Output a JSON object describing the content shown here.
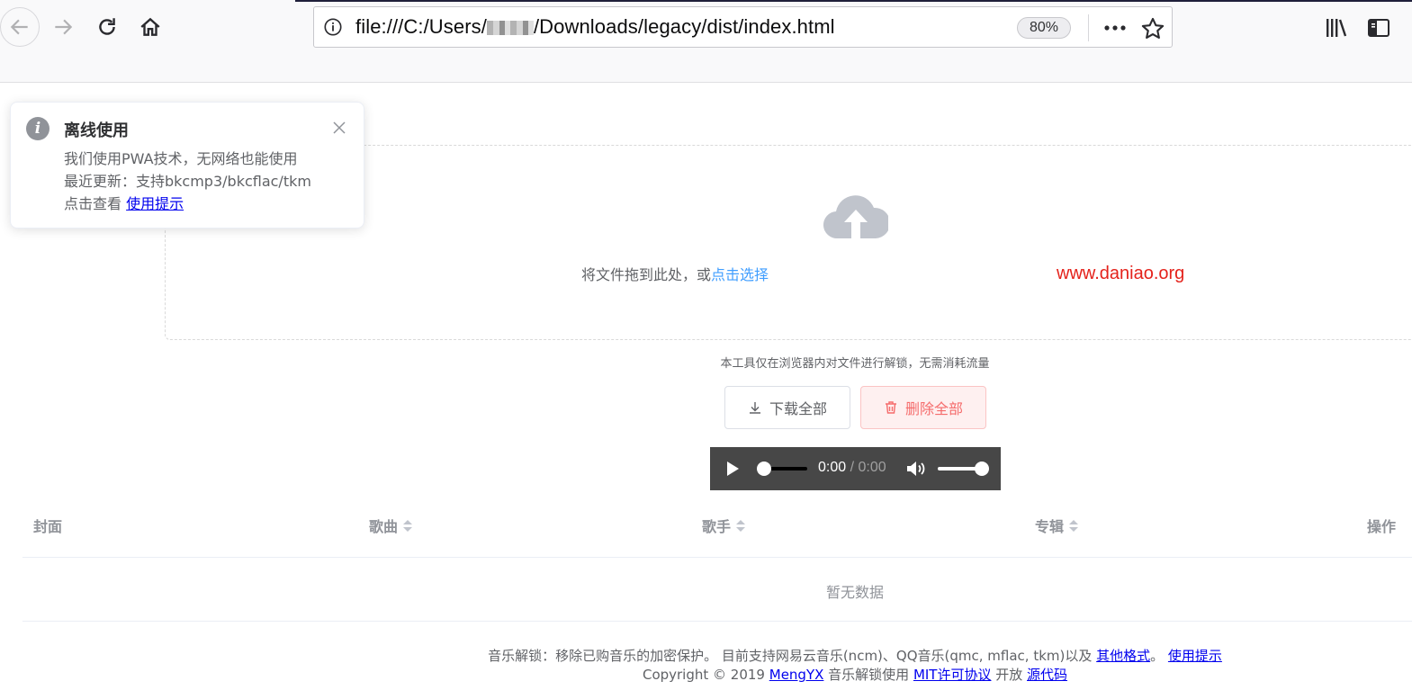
{
  "browser": {
    "url_prefix": "file:///C:/Users/",
    "url_suffix": "/Downloads/legacy/dist/index.html",
    "zoom": "80%",
    "more_icon": "more-dots-icon",
    "star_icon": "bookmark-star-icon"
  },
  "notification": {
    "title": "离线使用",
    "line1": "我们使用PWA技术，无网络也能使用",
    "line2": "最近更新：支持bkcmp3/bkcflac/tkm",
    "line3_prefix": "点击查看 ",
    "line3_link": "使用提示"
  },
  "upload": {
    "text": "将文件拖到此处，或",
    "link": "点击选择"
  },
  "watermark": "www.daniao.org",
  "tip": "本工具仅在浏览器内对文件进行解锁，无需消耗流量",
  "buttons": {
    "download_all": "下载全部",
    "delete_all": "删除全部"
  },
  "player": {
    "current": "0:00",
    "separator": " / ",
    "duration": "0:00",
    "progress": 0,
    "volume": 1.0
  },
  "table": {
    "columns": [
      "封面",
      "歌曲",
      "歌手",
      "专辑",
      "操作"
    ],
    "empty_text": "暂无数据"
  },
  "footer": {
    "line1_text": "音乐解锁：移除已购音乐的加密保护。 目前支持网易云音乐(ncm)、QQ音乐(qmc, mflac, tkm)以及 ",
    "line1_link1": "其他格式",
    "line1_mid": "。 ",
    "line1_link2": "使用提示",
    "line2_prefix": "Copyright © 2019 ",
    "line2_author": "MengYX",
    "line2_mid": " 音乐解锁使用 ",
    "line2_license": "MIT许可协议",
    "line2_mid2": " 开放 ",
    "line2_source": "源代码"
  },
  "colors": {
    "accent": "#409eff",
    "danger": "#f56c6c",
    "watermark": "#e4221b"
  }
}
